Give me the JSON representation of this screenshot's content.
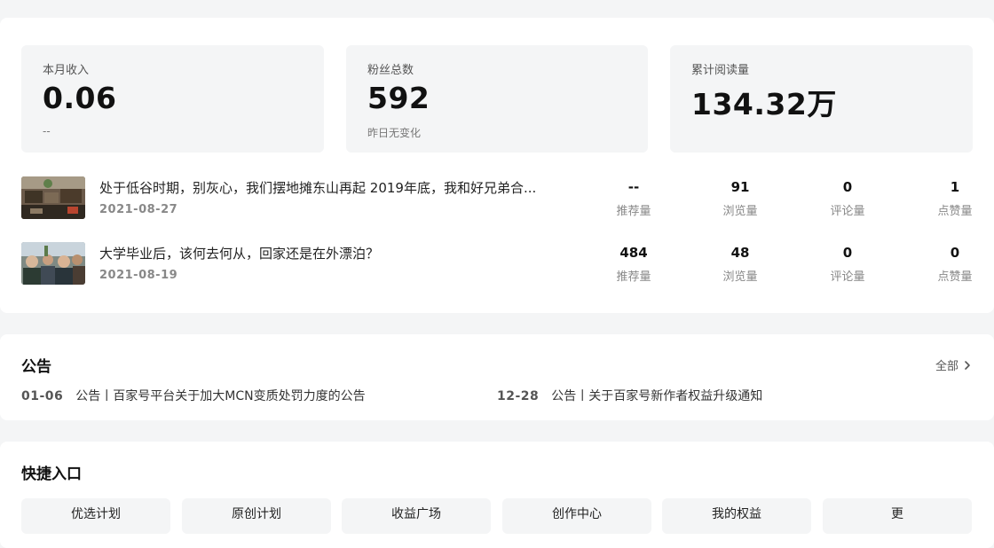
{
  "stats": [
    {
      "label": "本月收入",
      "value": "0.06",
      "sub": "--"
    },
    {
      "label": "粉丝总数",
      "value": "592",
      "sub": "昨日无变化"
    },
    {
      "label": "累计阅读量",
      "value": "134.32万",
      "sub": ""
    }
  ],
  "articles": [
    {
      "title": "处于低谷时期，别灰心，我们摆地摊东山再起 2019年底，我和好兄弟合...",
      "date": "2021-08-27",
      "metrics": [
        {
          "value": "--",
          "label": "推荐量"
        },
        {
          "value": "91",
          "label": "浏览量"
        },
        {
          "value": "0",
          "label": "评论量"
        },
        {
          "value": "1",
          "label": "点赞量"
        }
      ]
    },
    {
      "title": "大学毕业后，该何去何从，回家还是在外漂泊？",
      "date": "2021-08-19",
      "metrics": [
        {
          "value": "484",
          "label": "推荐量"
        },
        {
          "value": "48",
          "label": "浏览量"
        },
        {
          "value": "0",
          "label": "评论量"
        },
        {
          "value": "0",
          "label": "点赞量"
        }
      ]
    }
  ],
  "notice": {
    "title": "公告",
    "more": "全部",
    "items": [
      {
        "date": "01-06",
        "text": "公告丨百家号平台关于加大MCN变质处罚力度的公告"
      },
      {
        "date": "12-28",
        "text": "公告丨关于百家号新作者权益升级通知"
      }
    ]
  },
  "quick": {
    "title": "快捷入口",
    "items": [
      "优选计划",
      "原创计划",
      "收益广场",
      "创作中心",
      "我的权益",
      "更"
    ]
  },
  "colors": {
    "card": "#ffffff",
    "background": "#f4f5f6",
    "statBox": "#f4f5f6"
  }
}
